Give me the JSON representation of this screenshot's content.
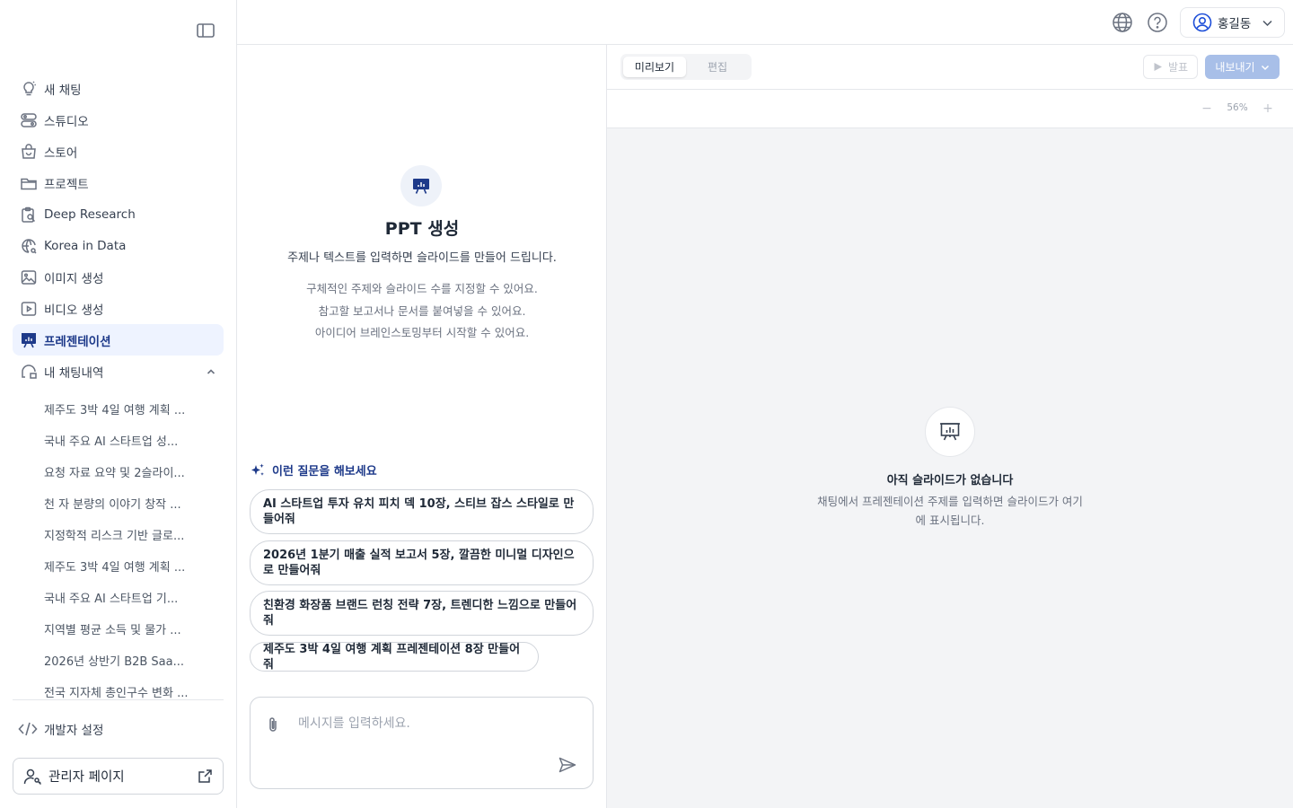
{
  "sidebar": {
    "nav": [
      {
        "label": "새 채팅",
        "icon": "chat-bulb-icon"
      },
      {
        "label": "스튜디오",
        "icon": "studio-icon"
      },
      {
        "label": "스토어",
        "icon": "store-bag-icon"
      },
      {
        "label": "프로젝트",
        "icon": "folder-icon"
      },
      {
        "label": "Deep Research",
        "icon": "clipboard-search-icon"
      },
      {
        "label": "Korea in Data",
        "icon": "globe-search-icon"
      },
      {
        "label": "이미지 생성",
        "icon": "image-icon"
      },
      {
        "label": "비디오 생성",
        "icon": "video-icon"
      },
      {
        "label": "프레젠테이션",
        "icon": "presentation-icon",
        "active": true
      },
      {
        "label": "내 채팅내역",
        "icon": "chat-history-icon"
      }
    ],
    "history": [
      "제주도 3박 4일 여행 계획 ...",
      "국내 주요 AI 스타트업 성...",
      "요청 자료 요약 및 2슬라이...",
      "천 자 분량의 이야기 창작 ...",
      "지정학적 리스크 기반 글로...",
      "제주도 3박 4일 여행 계획 ...",
      "국내 주요 AI 스타트업 기...",
      "지역별 평균 소득 및 물가 ...",
      "2026년 상반기 B2B Saa...",
      "전국 지자체 총인구수 변화 ..."
    ],
    "dev_settings": "개발자 설정",
    "admin_page": "관리자 페이지"
  },
  "topbar": {
    "user_name": "홍길동"
  },
  "chat": {
    "title": "PPT 생성",
    "subtitle": "주제나 텍스트를 입력하면 슬라이드를 만들어 드립니다.",
    "tips": [
      "구체적인 주제와 슬라이드 수를 지정할 수 있어요.",
      "참고할 보고서나 문서를 붙여넣을 수 있어요.",
      "아이디어 브레인스토밍부터 시작할 수 있어요."
    ],
    "suggest_heading": "이런 질문을 해보세요",
    "suggestions": [
      "AI 스타트업 투자 유치 피치 덱 10장, 스티브 잡스 스타일로 만들어줘",
      "2026년 1분기 매출 실적 보고서 5장, 깔끔한 미니멀 디자인으로 만들어줘",
      "친환경 화장품 브랜드 런칭 전략 7장, 트렌디한 느낌으로 만들어줘",
      "제주도 3박 4일 여행 계획 프레젠테이션 8장 만들어줘"
    ],
    "input_placeholder": "메시지를 입력하세요.",
    "input_value": ""
  },
  "preview": {
    "tabs": [
      "미리보기",
      "편집"
    ],
    "active_tab": 0,
    "present_label": "발표",
    "export_label": "내보내기",
    "zoom_minus": "−",
    "zoom_level": "56%",
    "zoom_plus": "+",
    "empty_title": "아직 슬라이드가 없습니다",
    "empty_desc": "채팅에서 프레젠테이션 주제를 입력하면 슬라이드가 여기에 표시됩니다."
  },
  "colors": {
    "accent": "#1e3a8a",
    "active_bg": "#eef3ff",
    "export_disabled": "#a8bfe8"
  }
}
